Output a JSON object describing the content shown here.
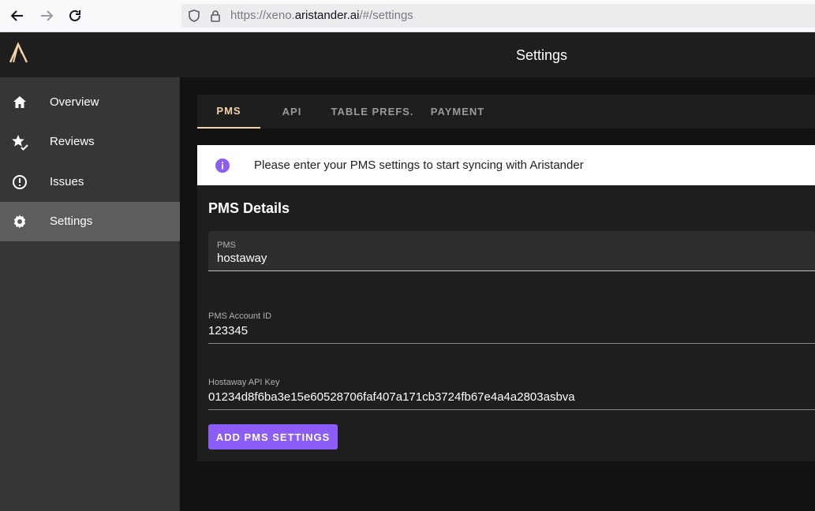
{
  "browser": {
    "url_prefix": "https://xeno.",
    "url_host": "aristander.ai",
    "url_suffix": "/#/settings"
  },
  "header": {
    "title": "Settings"
  },
  "sidebar": {
    "items": [
      {
        "label": "Overview",
        "icon": "home-icon"
      },
      {
        "label": "Reviews",
        "icon": "star-check-icon"
      },
      {
        "label": "Issues",
        "icon": "alert-circle-icon"
      },
      {
        "label": "Settings",
        "icon": "gear-icon",
        "active": true
      }
    ]
  },
  "tabs": [
    {
      "label": "PMS",
      "active": true
    },
    {
      "label": "API"
    },
    {
      "label": "TABLE PREFS."
    },
    {
      "label": "PAYMENT"
    }
  ],
  "alert": {
    "message": "Please enter your PMS settings to start syncing with Aristander",
    "icon": "info-icon"
  },
  "pms": {
    "title": "PMS Details",
    "pms_label": "PMS",
    "pms_value": "hostaway",
    "account_label": "PMS Account ID",
    "account_value": "123345",
    "api_key_label": "Hostaway API Key",
    "api_key_value": "01234d8f6ba3e15e60528706faf407a171cb3724fb67e4a4a2803asbva",
    "submit_label": "ADD PMS SETTINGS"
  },
  "colors": {
    "accent": "#f3d2a6",
    "button": "#8b5cf6",
    "info": "#8b5cf6"
  }
}
